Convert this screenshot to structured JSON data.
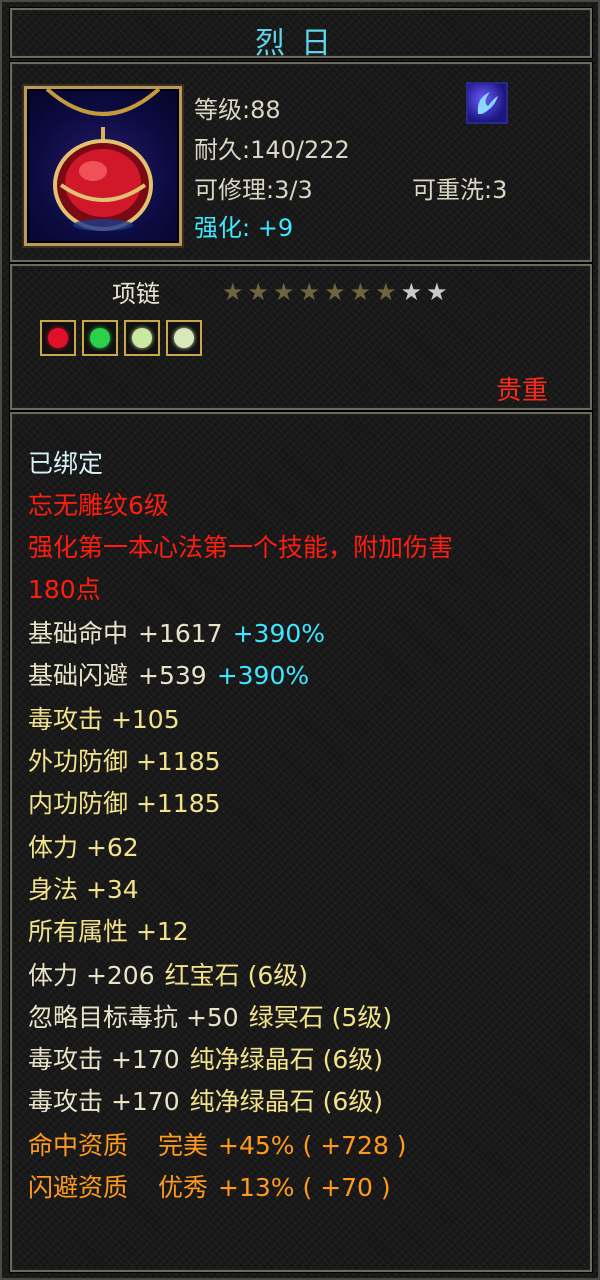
{
  "item": {
    "name": "烈日",
    "level": "等级:88",
    "durability": "耐久:140/222",
    "repair": "可修理:3/3",
    "rewash": "可重洗:3",
    "enhance": "强化: +9",
    "type": "项链",
    "stars": {
      "filled": 7,
      "total": 9
    },
    "rarity": "贵重",
    "colors": {
      "title": "#5fd4e8",
      "rarity": "#ff2a1a",
      "accent_cyan": "#3fe6ff",
      "star_filled": "#6d6440",
      "star_empty": "#c9c9c9"
    },
    "gems": [
      {
        "name": "ruby-gem-icon",
        "color": "#e0102a"
      },
      {
        "name": "green-gem-icon",
        "color": "#2ad14a"
      },
      {
        "name": "jade-gem-icon",
        "color": "#c9e8a0"
      },
      {
        "name": "jade-gem-icon",
        "color": "#d8e8b8"
      }
    ]
  },
  "props": {
    "bound": "已绑定",
    "engrave": "忘无雕纹6级",
    "skill_line1": "强化第一本心法第一个技能，附加伤害",
    "skill_line2": "180点",
    "hit_label": "基础命中",
    "hit_val": "+1617",
    "hit_pct": "+390%",
    "dodge_label": "基础闪避",
    "dodge_val": "+539",
    "dodge_pct": "+390%",
    "poison_atk": "毒攻击 +105",
    "outer_def": "外功防御 +1185",
    "inner_def": "内功防御 +1185",
    "stamina": "体力 +62",
    "agility": "身法 +34",
    "all_attr": "所有属性 +12",
    "gem1": "体力 +206",
    "gem1_name": "红宝石 (6级)",
    "gem2": "忽略目标毒抗 +50",
    "gem2_name": "绿冥石 (5级)",
    "gem3": "毒攻击 +170",
    "gem3_name": "纯净绿晶石 (6级)",
    "gem4": "毒攻击 +170",
    "gem4_name": "纯净绿晶石 (6级)",
    "apt1": "命中资质",
    "apt1_grade": "完美",
    "apt1_val": "+45% ( +728 )",
    "apt2": "闪避资质",
    "apt2_grade": "优秀",
    "apt2_val": "+13% ( +70 )"
  }
}
